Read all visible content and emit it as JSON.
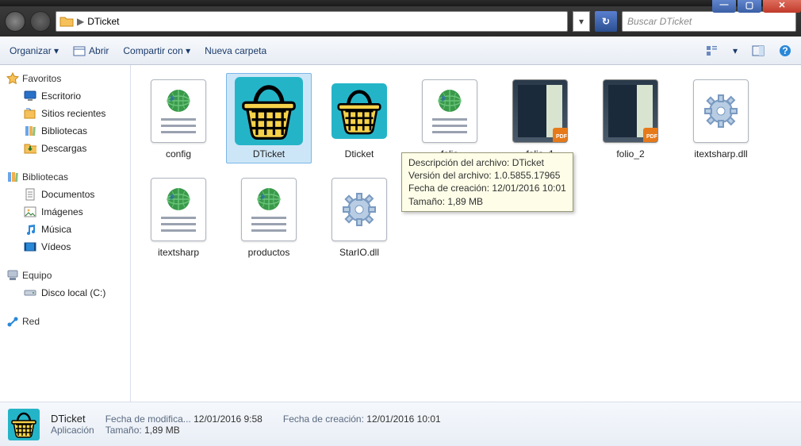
{
  "window": {
    "min": "—",
    "max": "▢",
    "close": "✕"
  },
  "breadcrumb": {
    "sep": "▶",
    "current": "DTicket"
  },
  "search": {
    "placeholder": "Buscar DTicket"
  },
  "toolbar": {
    "organize": "Organizar ▾",
    "open": "Abrir",
    "share": "Compartir con ▾",
    "newfolder": "Nueva carpeta"
  },
  "nav": {
    "favorites": "Favoritos",
    "desktop": "Escritorio",
    "recent": "Sitios recientes",
    "libraries_link": "Bibliotecas",
    "downloads": "Descargas",
    "libraries": "Bibliotecas",
    "documents": "Documentos",
    "images": "Imágenes",
    "music": "Música",
    "videos": "Vídeos",
    "computer": "Equipo",
    "localdisk": "Disco local (C:)",
    "network": "Red"
  },
  "files": [
    {
      "name": "config",
      "kind": "xml"
    },
    {
      "name": "DTicket",
      "kind": "app",
      "selected": true
    },
    {
      "name": "Dticket",
      "kind": "app-small"
    },
    {
      "name": "folio",
      "kind": "xml"
    },
    {
      "name": "folio_1",
      "kind": "pdf"
    },
    {
      "name": "folio_2",
      "kind": "pdf"
    },
    {
      "name": "itextsharp.dll",
      "kind": "dll"
    },
    {
      "name": "itextsharp",
      "kind": "xml"
    },
    {
      "name": "productos",
      "kind": "xml"
    },
    {
      "name": "StarIO.dll",
      "kind": "dll"
    }
  ],
  "tooltip": {
    "l1": "Descripción del archivo: DTicket",
    "l2": "Versión del archivo: 1.0.5855.17965",
    "l3": "Fecha de creación: 12/01/2016 10:01",
    "l4": "Tamaño: 1,89 MB"
  },
  "details": {
    "title": "DTicket",
    "type": "Aplicación",
    "mod_label": "Fecha de modifica...",
    "mod_value": "12/01/2016 9:58",
    "size_label": "Tamaño:",
    "size_value": "1,89 MB",
    "created_label": "Fecha de creación:",
    "created_value": "12/01/2016 10:01"
  }
}
